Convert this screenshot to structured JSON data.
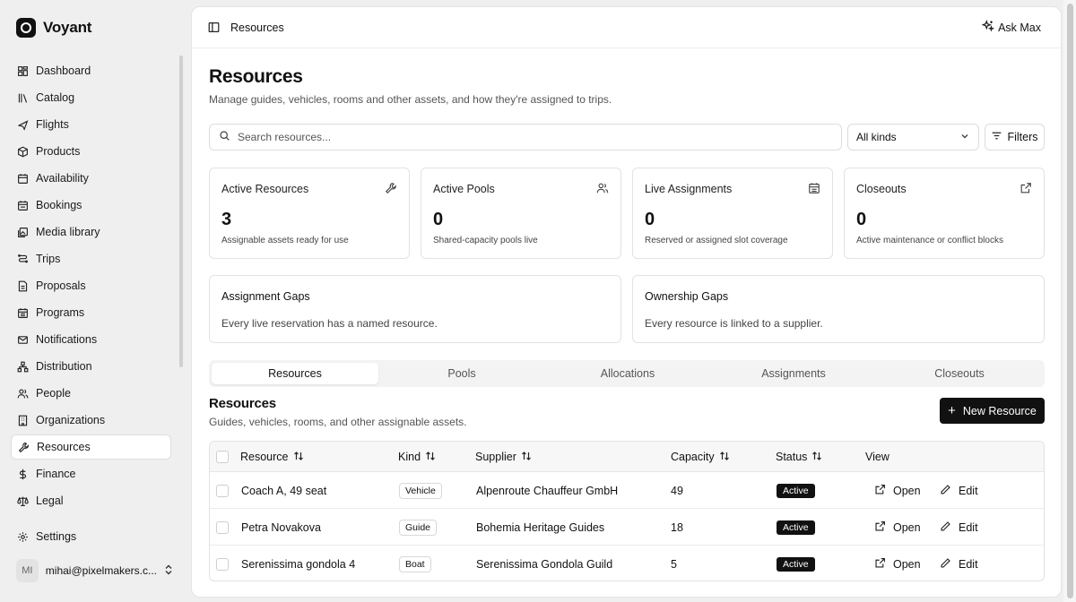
{
  "brand": {
    "name": "Voyant"
  },
  "sidebar": {
    "items": [
      {
        "label": "Dashboard",
        "icon": "dashboard-icon"
      },
      {
        "label": "Catalog",
        "icon": "catalog-icon"
      },
      {
        "label": "Flights",
        "icon": "plane-icon"
      },
      {
        "label": "Products",
        "icon": "box-icon"
      },
      {
        "label": "Availability",
        "icon": "calendar-icon"
      },
      {
        "label": "Bookings",
        "icon": "calendar-check-icon"
      },
      {
        "label": "Media library",
        "icon": "image-icon"
      },
      {
        "label": "Trips",
        "icon": "route-icon"
      },
      {
        "label": "Proposals",
        "icon": "document-icon"
      },
      {
        "label": "Programs",
        "icon": "calendar-grid-icon"
      },
      {
        "label": "Notifications",
        "icon": "mail-icon"
      },
      {
        "label": "Distribution",
        "icon": "network-icon"
      },
      {
        "label": "People",
        "icon": "people-icon"
      },
      {
        "label": "Organizations",
        "icon": "building-icon"
      },
      {
        "label": "Resources",
        "icon": "wrench-icon",
        "active": true
      },
      {
        "label": "Finance",
        "icon": "dollar-icon"
      },
      {
        "label": "Legal",
        "icon": "scale-icon"
      }
    ],
    "settings": "Settings",
    "user": {
      "initials": "MI",
      "email": "mihai@pixelmakers.c..."
    }
  },
  "topbar": {
    "breadcrumb": "Resources",
    "ask": "Ask Max"
  },
  "page": {
    "title": "Resources",
    "subtitle": "Manage guides, vehicles, rooms and other assets, and how they're assigned to trips.",
    "search_placeholder": "Search resources...",
    "kind_select": "All kinds",
    "filters": "Filters"
  },
  "stats": [
    {
      "label": "Active Resources",
      "value": "3",
      "desc": "Assignable assets ready for use",
      "icon": "wrench-icon"
    },
    {
      "label": "Active Pools",
      "value": "0",
      "desc": "Shared-capacity pools live",
      "icon": "people-icon"
    },
    {
      "label": "Live Assignments",
      "value": "0",
      "desc": "Reserved or assigned slot coverage",
      "icon": "calendar-icon"
    },
    {
      "label": "Closeouts",
      "value": "0",
      "desc": "Active maintenance or conflict blocks",
      "icon": "external-link-icon"
    }
  ],
  "gaps": [
    {
      "title": "Assignment Gaps",
      "text": "Every live reservation has a named resource."
    },
    {
      "title": "Ownership Gaps",
      "text": "Every resource is linked to a supplier."
    }
  ],
  "tabs": [
    "Resources",
    "Pools",
    "Allocations",
    "Assignments",
    "Closeouts"
  ],
  "section": {
    "title": "Resources",
    "subtitle": "Guides, vehicles, rooms, and other assignable assets.",
    "new_button": "New Resource"
  },
  "table": {
    "headers": {
      "resource": "Resource",
      "kind": "Kind",
      "supplier": "Supplier",
      "capacity": "Capacity",
      "status": "Status",
      "view": "View"
    },
    "rows": [
      {
        "resource": "Coach A, 49 seat",
        "kind": "Vehicle",
        "supplier": "Alpenroute Chauffeur GmbH",
        "capacity": "49",
        "status": "Active",
        "open": "Open",
        "edit": "Edit"
      },
      {
        "resource": "Petra Novakova",
        "kind": "Guide",
        "supplier": "Bohemia Heritage Guides",
        "capacity": "18",
        "status": "Active",
        "open": "Open",
        "edit": "Edit"
      },
      {
        "resource": "Serenissima gondola 4",
        "kind": "Boat",
        "supplier": "Serenissima Gondola Guild",
        "capacity": "5",
        "status": "Active",
        "open": "Open",
        "edit": "Edit"
      }
    ]
  },
  "colors": {
    "accent": "#111111",
    "background": "#efefef",
    "surface": "#ffffff",
    "border": "#e2e2e2"
  }
}
